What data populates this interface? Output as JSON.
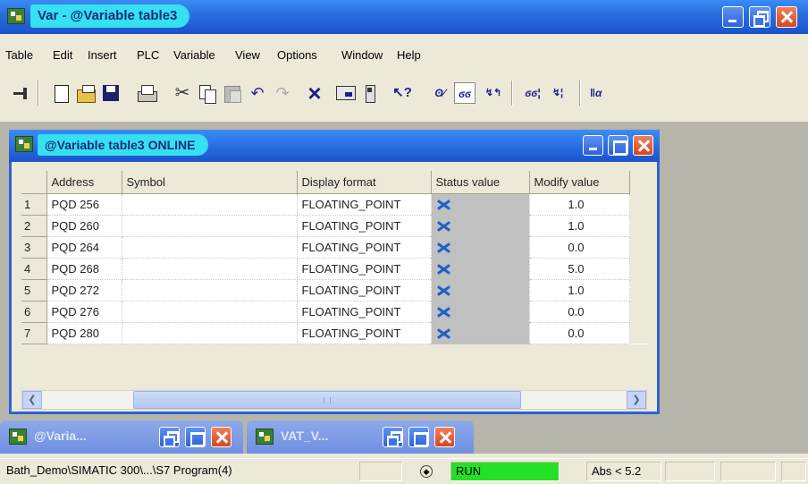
{
  "window": {
    "title": "Var - @Variable table3"
  },
  "menu": [
    "Table",
    "Edit",
    "Insert",
    "PLC",
    "Variable",
    "View",
    "Options",
    "Window",
    "Help"
  ],
  "child_window": {
    "title": "@Variable table3  ONLINE",
    "columns": [
      "",
      "Address",
      "Symbol",
      "Display format",
      "Status value",
      "Modify value"
    ],
    "rows": [
      {
        "num": "1",
        "address": "PQD  256",
        "symbol": "",
        "format": "FLOATING_POINT",
        "modify": "1.0"
      },
      {
        "num": "2",
        "address": "PQD  260",
        "symbol": "",
        "format": "FLOATING_POINT",
        "modify": "1.0"
      },
      {
        "num": "3",
        "address": "PQD  264",
        "symbol": "",
        "format": "FLOATING_POINT",
        "modify": "0.0"
      },
      {
        "num": "4",
        "address": "PQD  268",
        "symbol": "",
        "format": "FLOATING_POINT",
        "modify": "5.0"
      },
      {
        "num": "5",
        "address": "PQD  272",
        "symbol": "",
        "format": "FLOATING_POINT",
        "modify": "1.0"
      },
      {
        "num": "6",
        "address": "PQD  276",
        "symbol": "",
        "format": "FLOATING_POINT",
        "modify": "0.0"
      },
      {
        "num": "7",
        "address": "PQD  280",
        "symbol": "",
        "format": "FLOATING_POINT",
        "modify": "0.0"
      }
    ]
  },
  "minimized_windows": [
    {
      "title": "@Varia..."
    },
    {
      "title": "VAT_V..."
    }
  ],
  "status_bar": {
    "path": "Bath_Demo\\SIMATIC 300\\...\\S7 Program(4)",
    "run_state": "RUN",
    "abs": "Abs < 5.2"
  },
  "colors": {
    "titlebar": "#2b6fe0",
    "title_pill": "#35e0f2",
    "status_value_bg": "#c0c0c0",
    "run_green": "#24e024",
    "mdi_bg": "#b7b5a9"
  }
}
